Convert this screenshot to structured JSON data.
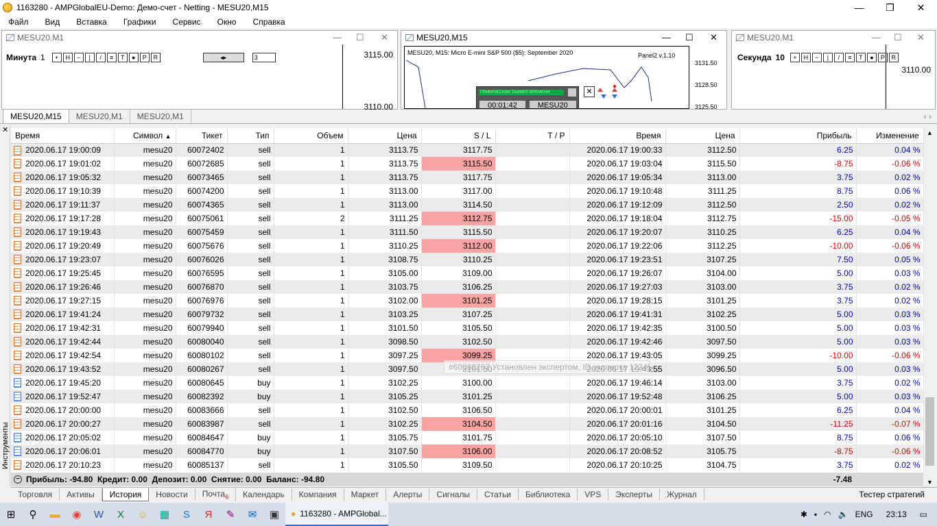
{
  "window": {
    "title": "1163280 - AMPGlobalEU-Demo: Демо-счет - Netting - MESU20,M15"
  },
  "menu": [
    "Файл",
    "Вид",
    "Вставка",
    "Графики",
    "Сервис",
    "Окно",
    "Справка"
  ],
  "charts": {
    "left": {
      "title": "MESU20,M1",
      "tf_label": "Минута",
      "tf_value": "1",
      "spin_value": "3",
      "price_top": "3115.00",
      "price_bottom": "3110.00"
    },
    "center": {
      "title": "MESU20,M15",
      "info": "MESU20, M15:  Micro E-mini S&P 500 ($5): September 2020",
      "panel": "Panel2 v.1.10",
      "prices": [
        "3131.50",
        "3128.50",
        "3125.50"
      ],
      "timer_title": "ГРАФИЧЕСКИЙ ТАЙМЕР ВРЕМЕНИ",
      "timer_value": "00:01:42",
      "timer_symbol": "MESU20"
    },
    "right": {
      "title": "MESU20,M1",
      "tf_label": "Секунда",
      "tf_value": "10",
      "price_top": "3110.00"
    }
  },
  "chart_tabs": [
    "MESU20,M15",
    "MESU20,M1",
    "MESU20,M1"
  ],
  "sidebar_label": "Инструменты",
  "columns": [
    "Время",
    "Символ",
    "Тикет",
    "Тип",
    "Объем",
    "Цена",
    "S / L",
    "T / P",
    "Время",
    "Цена",
    "Прибыль",
    "Изменение"
  ],
  "rows": [
    {
      "t1": "2020.06.17 19:00:09",
      "sym": "mesu20",
      "ticket": "60072402",
      "type": "sell",
      "vol": "1",
      "p1": "3113.75",
      "sl": "3117.75",
      "sl_hit": false,
      "tp": "",
      "t2": "2020.06.17 19:00:33",
      "p2": "3112.50",
      "profit": "6.25",
      "chg": "0.04 %",
      "neg": false
    },
    {
      "t1": "2020.06.17 19:01:02",
      "sym": "mesu20",
      "ticket": "60072685",
      "type": "sell",
      "vol": "1",
      "p1": "3113.75",
      "sl": "3115.50",
      "sl_hit": true,
      "tp": "",
      "t2": "2020.06.17 19:03:04",
      "p2": "3115.50",
      "profit": "-8.75",
      "chg": "-0.06 %",
      "neg": true
    },
    {
      "t1": "2020.06.17 19:05:32",
      "sym": "mesu20",
      "ticket": "60073465",
      "type": "sell",
      "vol": "1",
      "p1": "3113.75",
      "sl": "3117.75",
      "sl_hit": false,
      "tp": "",
      "t2": "2020.06.17 19:05:34",
      "p2": "3113.00",
      "profit": "3.75",
      "chg": "0.02 %",
      "neg": false
    },
    {
      "t1": "2020.06.17 19:10:39",
      "sym": "mesu20",
      "ticket": "60074200",
      "type": "sell",
      "vol": "1",
      "p1": "3113.00",
      "sl": "3117.00",
      "sl_hit": false,
      "tp": "",
      "t2": "2020.06.17 19:10:48",
      "p2": "3111.25",
      "profit": "8.75",
      "chg": "0.06 %",
      "neg": false
    },
    {
      "t1": "2020.06.17 19:11:37",
      "sym": "mesu20",
      "ticket": "60074365",
      "type": "sell",
      "vol": "1",
      "p1": "3113.00",
      "sl": "3114.50",
      "sl_hit": false,
      "tp": "",
      "t2": "2020.06.17 19:12:09",
      "p2": "3112.50",
      "profit": "2.50",
      "chg": "0.02 %",
      "neg": false
    },
    {
      "t1": "2020.06.17 19:17:28",
      "sym": "mesu20",
      "ticket": "60075061",
      "type": "sell",
      "vol": "2",
      "p1": "3111.25",
      "sl": "3112.75",
      "sl_hit": true,
      "tp": "",
      "t2": "2020.06.17 19:18:04",
      "p2": "3112.75",
      "profit": "-15.00",
      "chg": "-0.05 %",
      "neg": true
    },
    {
      "t1": "2020.06.17 19:19:43",
      "sym": "mesu20",
      "ticket": "60075459",
      "type": "sell",
      "vol": "1",
      "p1": "3111.50",
      "sl": "3115.50",
      "sl_hit": false,
      "tp": "",
      "t2": "2020.06.17 19:20:07",
      "p2": "3110.25",
      "profit": "6.25",
      "chg": "0.04 %",
      "neg": false
    },
    {
      "t1": "2020.06.17 19:20:49",
      "sym": "mesu20",
      "ticket": "60075676",
      "type": "sell",
      "vol": "1",
      "p1": "3110.25",
      "sl": "3112.00",
      "sl_hit": true,
      "tp": "",
      "t2": "2020.06.17 19:22:06",
      "p2": "3112.25",
      "profit": "-10.00",
      "chg": "-0.06 %",
      "neg": true
    },
    {
      "t1": "2020.06.17 19:23:07",
      "sym": "mesu20",
      "ticket": "60076026",
      "type": "sell",
      "vol": "1",
      "p1": "3108.75",
      "sl": "3110.25",
      "sl_hit": false,
      "tp": "",
      "t2": "2020.06.17 19:23:51",
      "p2": "3107.25",
      "profit": "7.50",
      "chg": "0.05 %",
      "neg": false
    },
    {
      "t1": "2020.06.17 19:25:45",
      "sym": "mesu20",
      "ticket": "60076595",
      "type": "sell",
      "vol": "1",
      "p1": "3105.00",
      "sl": "3109.00",
      "sl_hit": false,
      "tp": "",
      "t2": "2020.06.17 19:26:07",
      "p2": "3104.00",
      "profit": "5.00",
      "chg": "0.03 %",
      "neg": false
    },
    {
      "t1": "2020.06.17 19:26:46",
      "sym": "mesu20",
      "ticket": "60076870",
      "type": "sell",
      "vol": "1",
      "p1": "3103.75",
      "sl": "3106.25",
      "sl_hit": false,
      "tp": "",
      "t2": "2020.06.17 19:27:03",
      "p2": "3103.00",
      "profit": "3.75",
      "chg": "0.02 %",
      "neg": false
    },
    {
      "t1": "2020.06.17 19:27:15",
      "sym": "mesu20",
      "ticket": "60076976",
      "type": "sell",
      "vol": "1",
      "p1": "3102.00",
      "sl": "3101.25",
      "sl_hit": true,
      "tp": "",
      "t2": "2020.06.17 19:28:15",
      "p2": "3101.25",
      "profit": "3.75",
      "chg": "0.02 %",
      "neg": false
    },
    {
      "t1": "2020.06.17 19:41:24",
      "sym": "mesu20",
      "ticket": "60079732",
      "type": "sell",
      "vol": "1",
      "p1": "3103.25",
      "sl": "3107.25",
      "sl_hit": false,
      "tp": "",
      "t2": "2020.06.17 19:41:31",
      "p2": "3102.25",
      "profit": "5.00",
      "chg": "0.03 %",
      "neg": false
    },
    {
      "t1": "2020.06.17 19:42:31",
      "sym": "mesu20",
      "ticket": "60079940",
      "type": "sell",
      "vol": "1",
      "p1": "3101.50",
      "sl": "3105.50",
      "sl_hit": false,
      "tp": "",
      "t2": "2020.06.17 19:42:35",
      "p2": "3100.50",
      "profit": "5.00",
      "chg": "0.03 %",
      "neg": false
    },
    {
      "t1": "2020.06.17 19:42:44",
      "sym": "mesu20",
      "ticket": "60080040",
      "type": "sell",
      "vol": "1",
      "p1": "3098.50",
      "sl": "3102.50",
      "sl_hit": false,
      "tp": "",
      "t2": "2020.06.17 19:42:46",
      "p2": "3097.50",
      "profit": "5.00",
      "chg": "0.03 %",
      "neg": false
    },
    {
      "t1": "2020.06.17 19:42:54",
      "sym": "mesu20",
      "ticket": "60080102",
      "type": "sell",
      "vol": "1",
      "p1": "3097.25",
      "sl": "3099.25",
      "sl_hit": true,
      "tp": "",
      "t2": "2020.06.17 19:43:05",
      "p2": "3099.25",
      "profit": "-10.00",
      "chg": "-0.06 %",
      "neg": true
    },
    {
      "t1": "2020.06.17 19:43:52",
      "sym": "mesu20",
      "ticket": "60080267",
      "type": "sell",
      "vol": "1",
      "p1": "3097.50",
      "sl": "3101.50",
      "sl_hit": false,
      "tp": "",
      "t2": "2020.06.17 19:43:55",
      "p2": "3096.50",
      "profit": "5.00",
      "chg": "0.03 %",
      "neg": false
    },
    {
      "t1": "2020.06.17 19:45:20",
      "sym": "mesu20",
      "ticket": "60080645",
      "type": "buy",
      "vol": "1",
      "p1": "3102.25",
      "sl": "3100.00",
      "sl_hit": false,
      "tp": "",
      "t2": "2020.06.17 19:46:14",
      "p2": "3103.00",
      "profit": "3.75",
      "chg": "0.02 %",
      "neg": false
    },
    {
      "t1": "2020.06.17 19:52:47",
      "sym": "mesu20",
      "ticket": "60082392",
      "type": "buy",
      "vol": "1",
      "p1": "3105.25",
      "sl": "3101.25",
      "sl_hit": false,
      "tp": "",
      "t2": "2020.06.17 19:52:48",
      "p2": "3106.25",
      "profit": "5.00",
      "chg": "0.03 %",
      "neg": false
    },
    {
      "t1": "2020.06.17 20:00:00",
      "sym": "mesu20",
      "ticket": "60083666",
      "type": "sell",
      "vol": "1",
      "p1": "3102.50",
      "sl": "3106.50",
      "sl_hit": false,
      "tp": "",
      "t2": "2020.06.17 20:00:01",
      "p2": "3101.25",
      "profit": "6.25",
      "chg": "0.04 %",
      "neg": false
    },
    {
      "t1": "2020.06.17 20:00:27",
      "sym": "mesu20",
      "ticket": "60083987",
      "type": "sell",
      "vol": "1",
      "p1": "3102.25",
      "sl": "3104.50",
      "sl_hit": true,
      "tp": "",
      "t2": "2020.06.17 20:01:16",
      "p2": "3104.50",
      "profit": "-11.25",
      "chg": "-0.07 %",
      "neg": true
    },
    {
      "t1": "2020.06.17 20:05:02",
      "sym": "mesu20",
      "ticket": "60084647",
      "type": "buy",
      "vol": "1",
      "p1": "3105.75",
      "sl": "3101.75",
      "sl_hit": false,
      "tp": "",
      "t2": "2020.06.17 20:05:10",
      "p2": "3107.50",
      "profit": "8.75",
      "chg": "0.06 %",
      "neg": false
    },
    {
      "t1": "2020.06.17 20:06:01",
      "sym": "mesu20",
      "ticket": "60084770",
      "type": "buy",
      "vol": "1",
      "p1": "3107.50",
      "sl": "3106.00",
      "sl_hit": true,
      "tp": "",
      "t2": "2020.06.17 20:08:52",
      "p2": "3105.75",
      "profit": "-8.75",
      "chg": "-0.06 %",
      "neg": true
    },
    {
      "t1": "2020.06.17 20:10:23",
      "sym": "mesu20",
      "ticket": "60085137",
      "type": "sell",
      "vol": "1",
      "p1": "3105.50",
      "sl": "3109.50",
      "sl_hit": false,
      "tp": "",
      "t2": "2020.06.17 20:10:25",
      "p2": "3104.75",
      "profit": "3.75",
      "chg": "0.02 %",
      "neg": false
    }
  ],
  "summary": {
    "text": "Прибыль: -94.80  Кредит: 0.00  Депозит: 0.00  Снятие: 0.00  Баланс: -94.80",
    "total": "-7.48"
  },
  "tooltip": "#60080267 Установлен экспертом, ID эксперта 1234567",
  "bottom_tabs": [
    "Торговля",
    "Активы",
    "История",
    "Новости",
    "Почта",
    "Календарь",
    "Компания",
    "Маркет",
    "Алерты",
    "Сигналы",
    "Статьи",
    "Библиотека",
    "VPS",
    "Эксперты",
    "Журнал"
  ],
  "mail_badge": "6",
  "tester": "Тестер стратегий",
  "taskbar": {
    "running_app": "1163280 - AMPGlobal...",
    "lang": "ENG",
    "clock": "23:13"
  },
  "colors": {
    "sl_hit_bg": "#f9a3a3",
    "profit_pos": "#0000cc",
    "profit_neg": "#e00000"
  }
}
